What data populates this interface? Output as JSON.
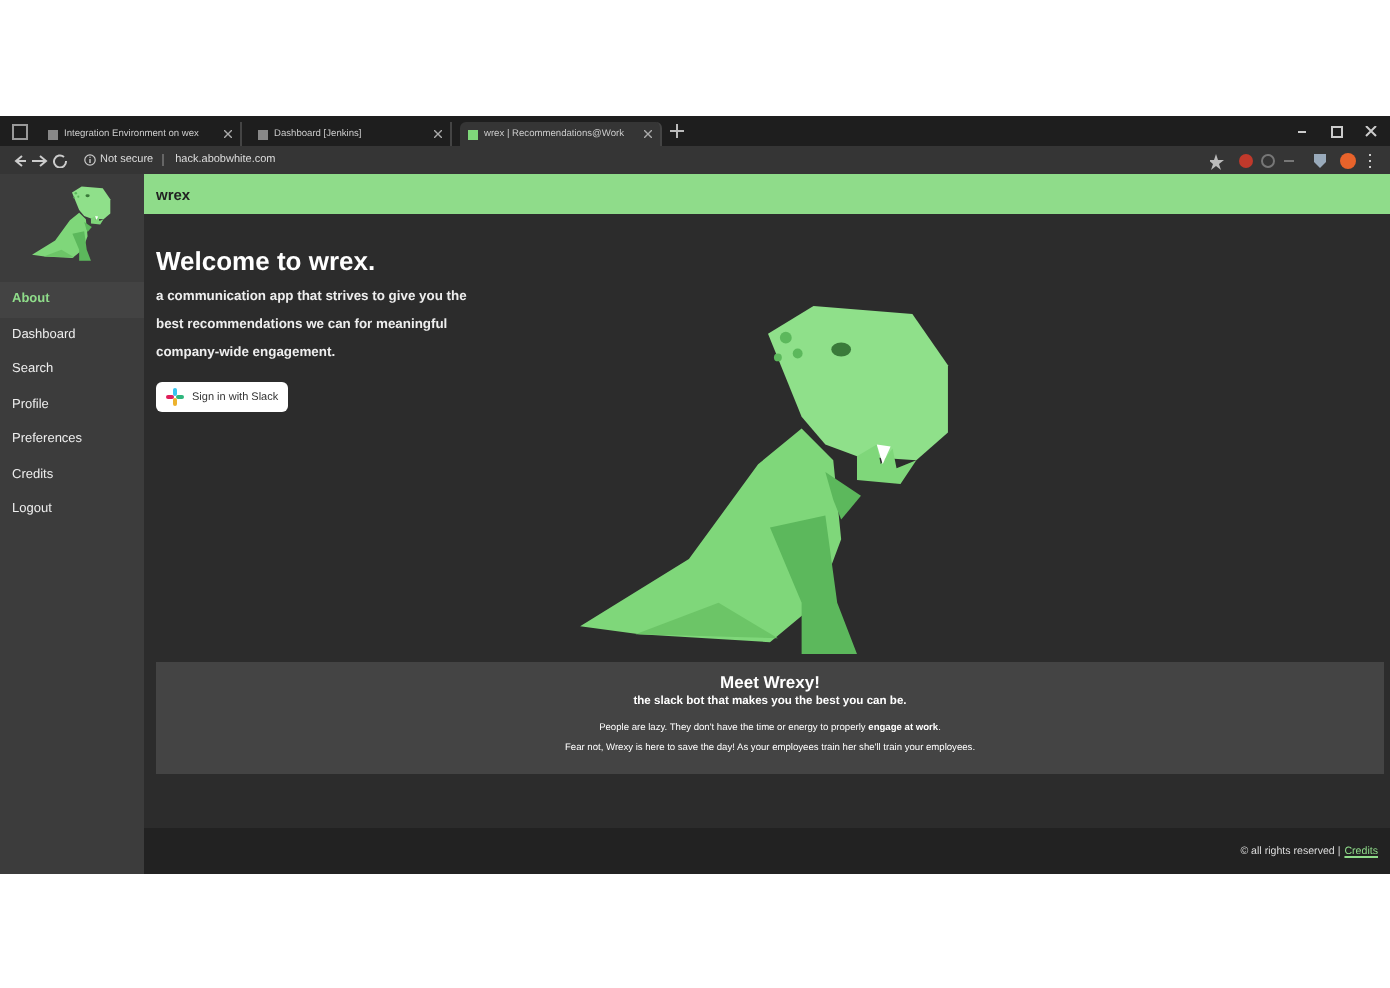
{
  "browser": {
    "tabs": [
      {
        "title": "Integration Environment on wex",
        "selected": false
      },
      {
        "title": "Dashboard [Jenkins]",
        "selected": false
      },
      {
        "title": "wrex | Recommendations@Work",
        "selected": true
      }
    ],
    "security": "Not secure",
    "url": "hack.abobwhite.com"
  },
  "header": {
    "title": "wrex"
  },
  "sidebar": {
    "items": [
      {
        "label": "About",
        "selected": true
      },
      {
        "label": "Dashboard",
        "selected": false
      },
      {
        "label": "Search",
        "selected": false
      },
      {
        "label": "Profile",
        "selected": false
      },
      {
        "label": "Preferences",
        "selected": false
      },
      {
        "label": "Credits",
        "selected": false
      },
      {
        "label": "Logout",
        "selected": false
      }
    ]
  },
  "hero": {
    "title": "Welcome to wrex.",
    "lines": [
      "a communication app that strives to give you the",
      "best recommendations we can for meaningful",
      "company-wide engagement."
    ],
    "button": "Sign in with Slack"
  },
  "about": {
    "title": "Meet Wrexy!",
    "subtitle": "the slack bot that makes you the best you can be.",
    "paragraphs": [
      "People are lazy. They don't have the time or energy to properly **engage at work**.",
      "Fear not, Wrexy is here to save the day! As your employees train her she'll train your employees."
    ]
  },
  "footer": {
    "text": "© all rights reserved |",
    "link": "Credits"
  }
}
